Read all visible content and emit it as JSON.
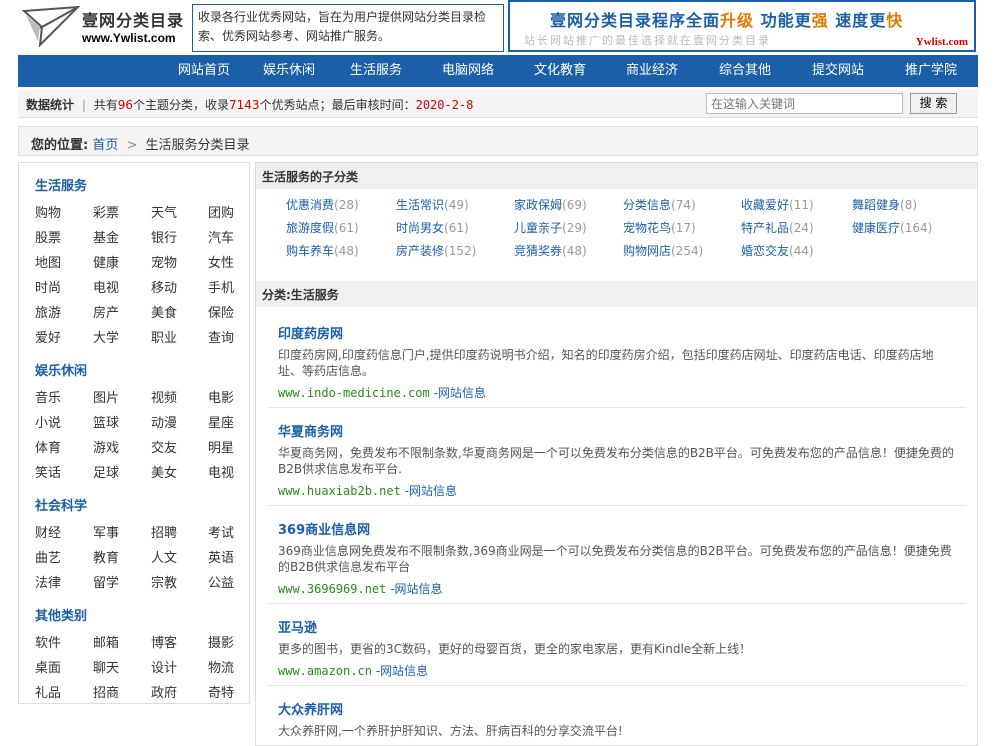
{
  "header": {
    "logo_name": "壹网分类目录",
    "logo_url": "www.Ywlist.com",
    "intro": "收录各行业优秀网站，旨在为用户提供网站分类目录检索、优秀网站参考、网站推广服务。",
    "banner_a": "壹网分类目录程序全面",
    "banner_hl1": "升级",
    "banner_b": "功能更",
    "banner_hl2": "强",
    "banner_c": "速度更",
    "banner_hl3": "快",
    "banner_line2": "站长网站推广的最佳选择就在壹网分类目录",
    "banner_brand": "Ywlist.com"
  },
  "nav": [
    "网站首页",
    "娱乐休闲",
    "生活服务",
    "电脑网络",
    "文化教育",
    "商业经济",
    "综合其他",
    "提交网站",
    "推广学院"
  ],
  "stats": {
    "label": "数据统计",
    "sep": "|",
    "t1": "共有",
    "topics": "96",
    "t2": "个主题分类，收录",
    "sites": "7143",
    "t3": "个优秀站点；最后审核时间：",
    "date": "2020-2-8",
    "search_placeholder": "在这输入关键词",
    "search_btn": "搜 索"
  },
  "crumb": {
    "label": "您的位置:",
    "home": "首页",
    "arrow": ">",
    "current": "生活服务分类目录"
  },
  "sidebar": [
    {
      "title": "生活服务",
      "items": [
        "购物",
        "彩票",
        "天气",
        "团购",
        "股票",
        "基金",
        "银行",
        "汽车",
        "地图",
        "健康",
        "宠物",
        "女性",
        "时尚",
        "电视",
        "移动",
        "手机",
        "旅游",
        "房产",
        "美食",
        "保险",
        "爱好",
        "大学",
        "职业",
        "查询"
      ]
    },
    {
      "title": "娱乐休闲",
      "items": [
        "音乐",
        "图片",
        "视频",
        "电影",
        "小说",
        "篮球",
        "动漫",
        "星座",
        "体育",
        "游戏",
        "交友",
        "明星",
        "笑话",
        "足球",
        "美女",
        "电视"
      ]
    },
    {
      "title": "社会科学",
      "items": [
        "财经",
        "军事",
        "招聘",
        "考试",
        "曲艺",
        "教育",
        "人文",
        "英语",
        "法律",
        "留学",
        "宗教",
        "公益"
      ]
    },
    {
      "title": "其他类别",
      "items": [
        "软件",
        "邮箱",
        "博客",
        "摄影",
        "桌面",
        "聊天",
        "设计",
        "物流",
        "礼品",
        "招商",
        "政府",
        "奇特"
      ]
    }
  ],
  "subcats": {
    "title": "生活服务的子分类",
    "items": [
      {
        "name": "优惠消费",
        "count": "(28)"
      },
      {
        "name": "生活常识",
        "count": "(49)"
      },
      {
        "name": "家政保姆",
        "count": "(69)"
      },
      {
        "name": "分类信息",
        "count": "(74)"
      },
      {
        "name": "收藏爱好",
        "count": "(11)"
      },
      {
        "name": "舞蹈健身",
        "count": "(8)"
      },
      {
        "name": "旅游度假",
        "count": "(61)"
      },
      {
        "name": "时尚男女",
        "count": "(61)"
      },
      {
        "name": "儿童亲子",
        "count": "(29)"
      },
      {
        "name": "宠物花鸟",
        "count": "(17)"
      },
      {
        "name": "特产礼品",
        "count": "(24)"
      },
      {
        "name": "健康医疗",
        "count": "(164)"
      },
      {
        "name": "购车养车",
        "count": "(48)"
      },
      {
        "name": "房产装修",
        "count": "(152)"
      },
      {
        "name": "竞猜奖券",
        "count": "(48)"
      },
      {
        "name": "购物网店",
        "count": "(254)"
      },
      {
        "name": "婚恋交友",
        "count": "(44)"
      }
    ]
  },
  "listing": {
    "title": "分类:生活服务",
    "info_label": "-网站信息",
    "entries": [
      {
        "title": "印度药房网",
        "desc": "印度药房网,印度药信息门户,提供印度药说明书介绍，知名的印度药房介绍，包括印度药店网址、印度药店电话、印度药店地址、等药店信息。",
        "url": "www.indo-medicine.com"
      },
      {
        "title": "华夏商务网",
        "desc": "华夏商务网，免费发布不限制条数,华夏商务网是一个可以免费发布分类信息的B2B平台。可免费发布您的产品信息！便捷免费的B2B供求信息发布平台.",
        "url": "www.huaxiab2b.net"
      },
      {
        "title": "369商业信息网",
        "desc": "369商业信息网免费发布不限制条数,369商业网是一个可以免费发布分类信息的B2B平台。可免费发布您的产品信息！便捷免费的B2B供求信息发布平台",
        "url": "www.3696969.net"
      },
      {
        "title": "亚马逊",
        "desc": "更多的图书，更省的3C数码，更好的母婴百货，更全的家电家居，更有Kindle全新上线！",
        "url": "www.amazon.cn"
      },
      {
        "title": "大众养肝网",
        "desc": "大众养肝网,一个养肝护肝知识、方法、肝病百科的分享交流平台!",
        "url": ""
      }
    ]
  }
}
